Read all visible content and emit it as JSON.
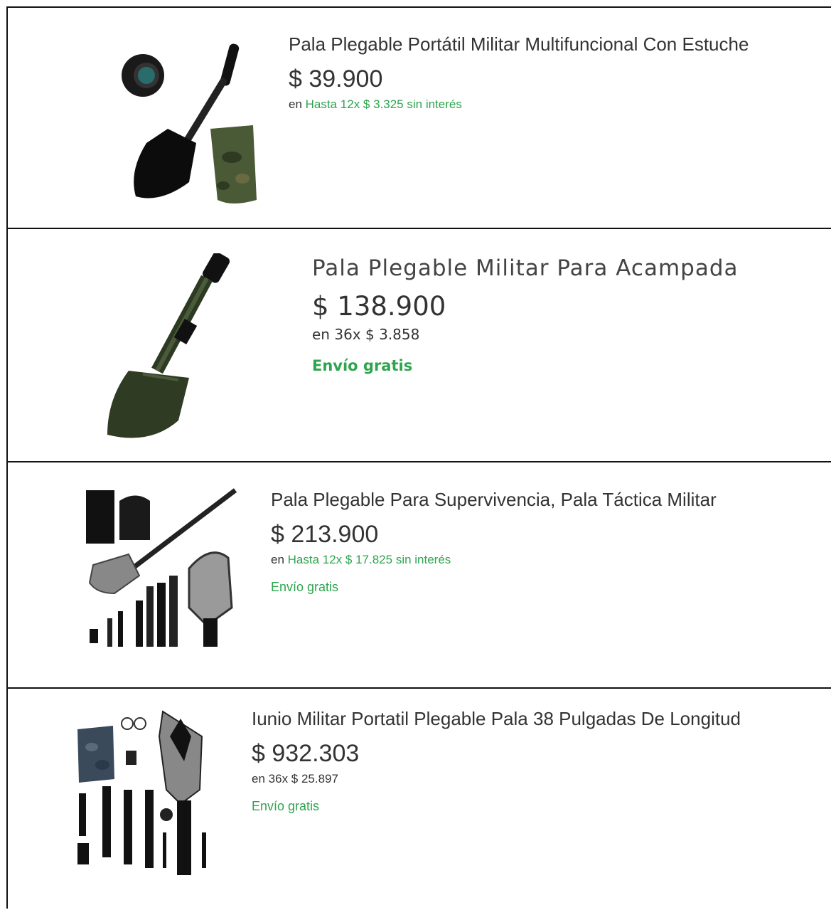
{
  "products": [
    {
      "title": "Pala Plegable Portátil Militar Multifuncional Con Estuche",
      "price": "$ 39.900",
      "installments_prefix": "en",
      "installments": "Hasta 12x $ 3.325 sin interés",
      "shipping": ""
    },
    {
      "title": "Pala Plegable Militar Para Acampada",
      "price": "$ 138.900",
      "installments_prefix": "en",
      "installments": "36x $ 3.858",
      "shipping": "Envío gratis"
    },
    {
      "title": "Pala Plegable Para Supervivencia, Pala Táctica Militar",
      "price": "$ 213.900",
      "installments_prefix": "en",
      "installments": "Hasta 12x $ 17.825 sin interés",
      "shipping": "Envío gratis"
    },
    {
      "title": "Iunio Militar Portatil Plegable Pala 38 Pulgadas De Longitud",
      "price": "$ 932.303",
      "installments_prefix": "en",
      "installments": "36x $ 25.897",
      "shipping": "Envío gratis"
    }
  ],
  "colors": {
    "text": "#333333",
    "accent_green": "#2ea44f",
    "border": "#111111"
  }
}
